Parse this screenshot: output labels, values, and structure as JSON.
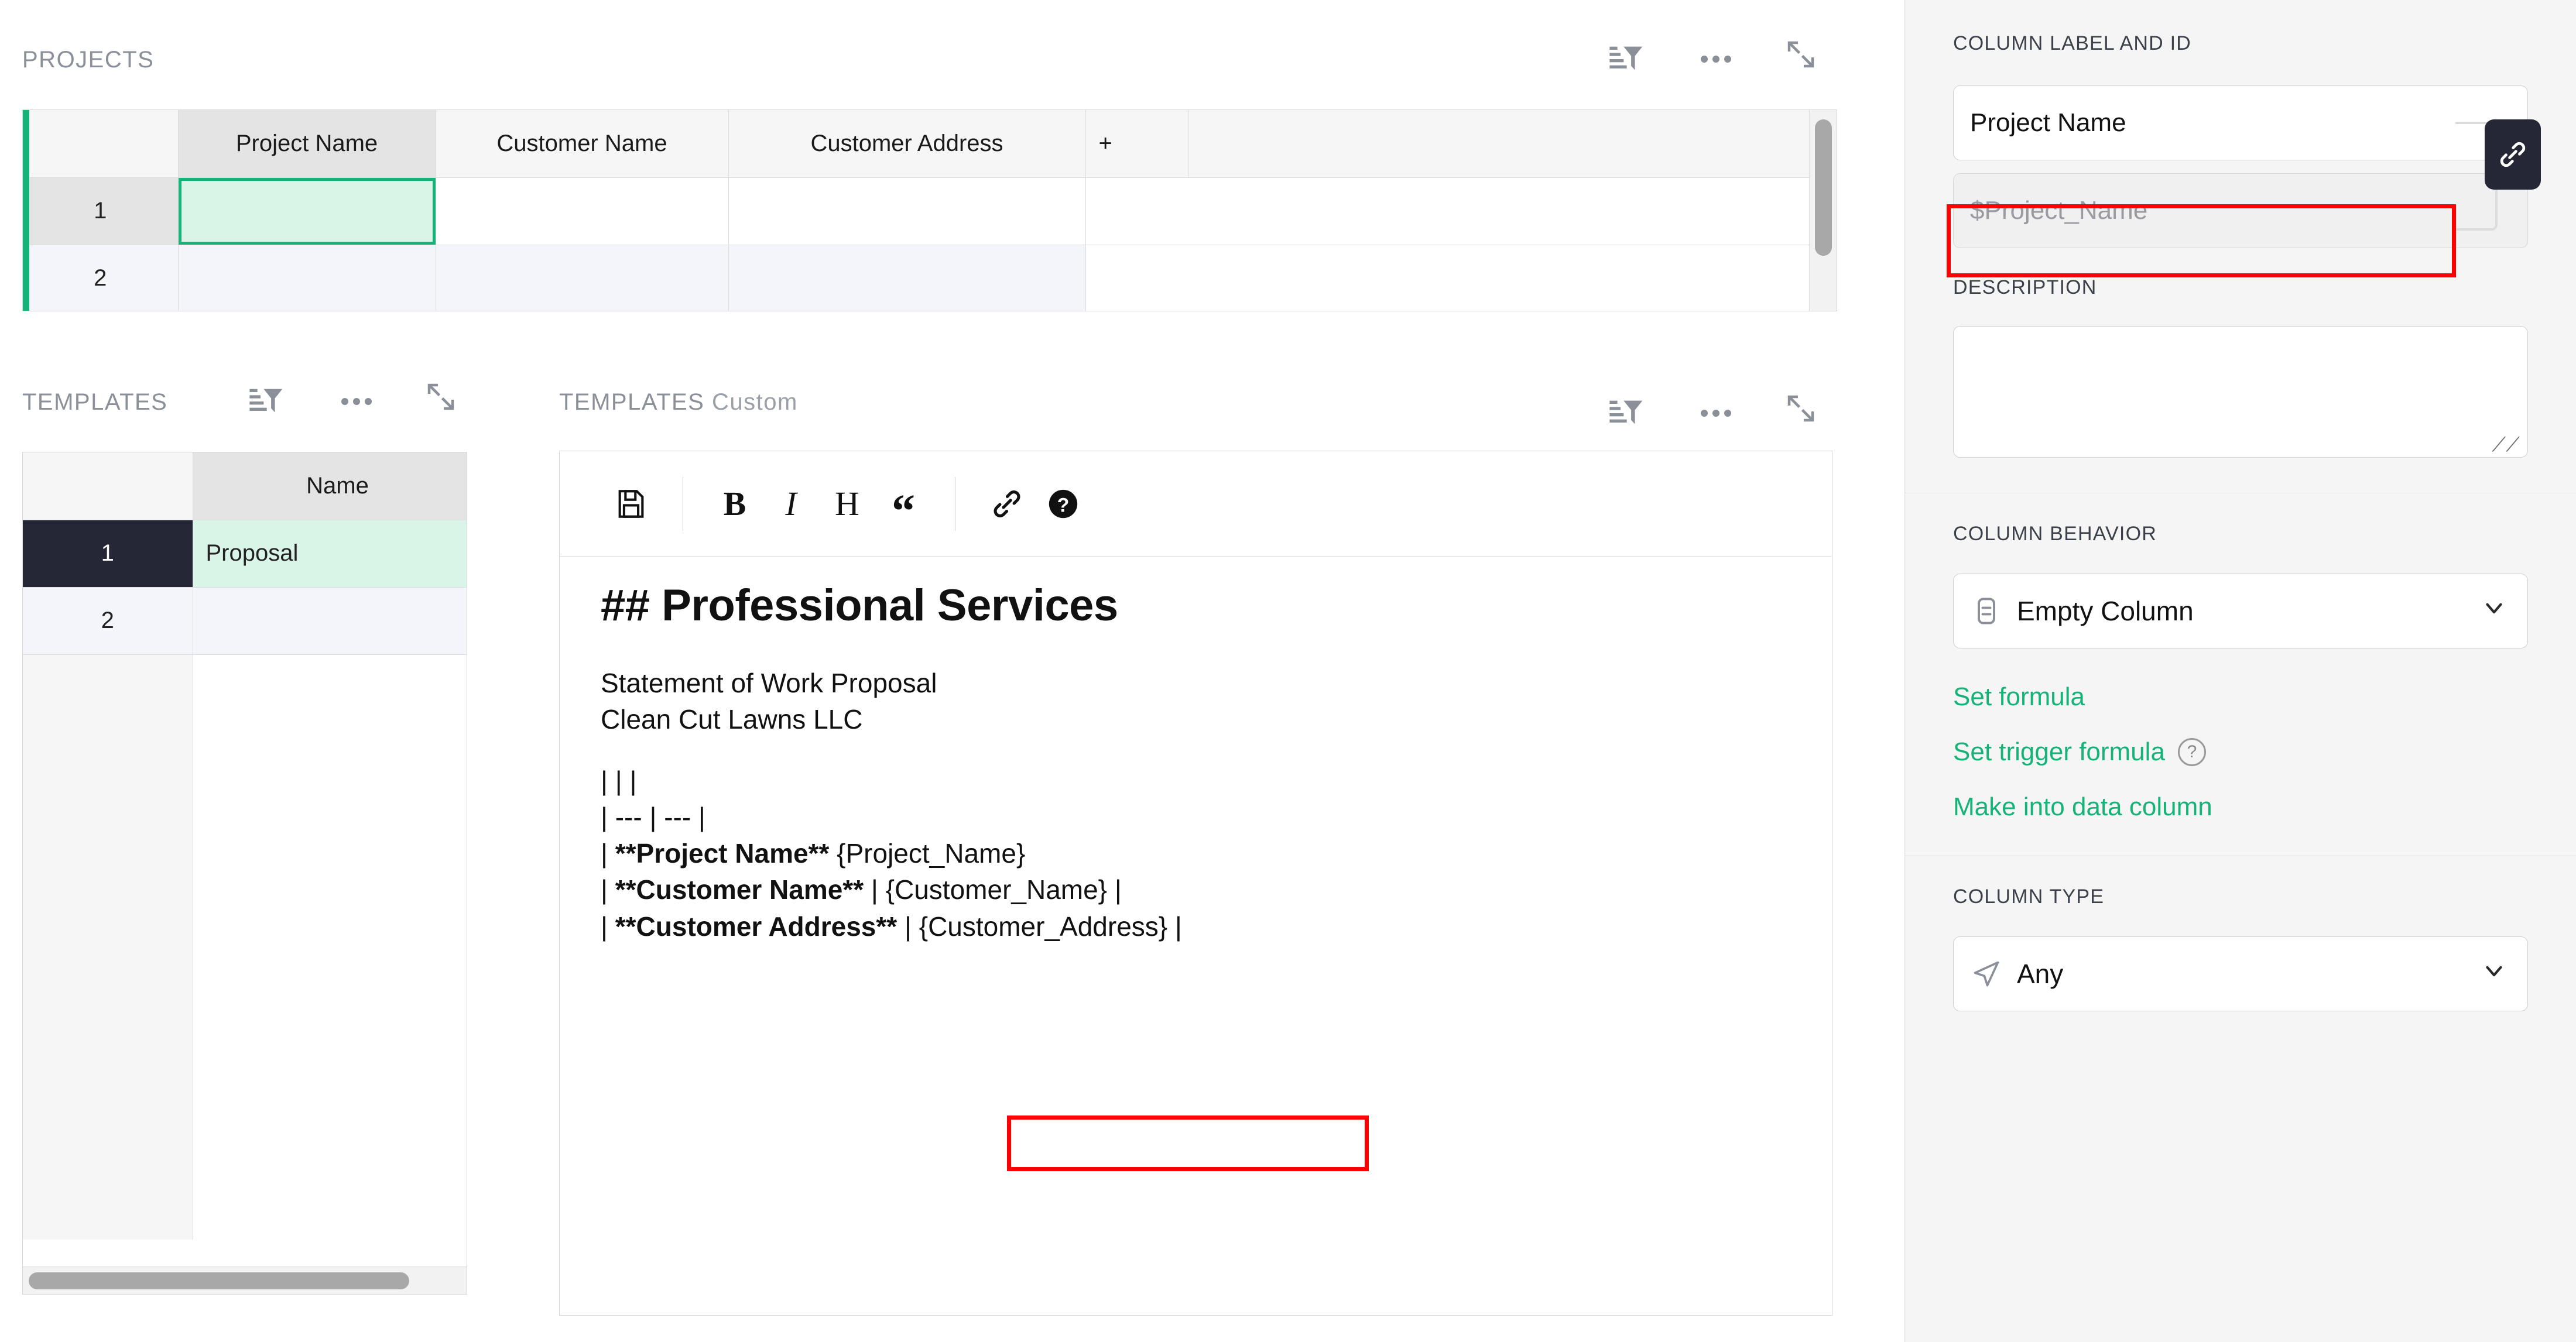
{
  "projects_panel": {
    "title": "PROJECTS",
    "icons": {
      "filter": "filter-sort-icon",
      "more": "more-options-icon",
      "expand": "expand-icon"
    },
    "columns": [
      "",
      "Project Name",
      "Customer Name",
      "Customer Address",
      "+",
      ""
    ],
    "active_column": "Project Name",
    "add_column_label": "+",
    "rows": [
      {
        "num": "1",
        "project_name": "",
        "customer_name": "",
        "customer_address": "",
        "selected": true
      },
      {
        "num": "2",
        "project_name": "",
        "customer_name": "",
        "customer_address": "",
        "selected": false
      }
    ]
  },
  "templates_panel": {
    "title": "TEMPLATES",
    "columns": [
      "",
      "Name"
    ],
    "rows": [
      {
        "num": "1",
        "name": "Proposal",
        "selected": true
      },
      {
        "num": "2",
        "name": "",
        "selected": false
      }
    ]
  },
  "templates_custom_panel": {
    "title_main": "TEMPLATES",
    "title_sub": "Custom",
    "toolbar": [
      {
        "id": "save-icon",
        "label": "save"
      },
      {
        "id": "bold-icon",
        "label": "B"
      },
      {
        "id": "italic-icon",
        "label": "I"
      },
      {
        "id": "heading-icon",
        "label": "H"
      },
      {
        "id": "quote-icon",
        "label": "“"
      },
      {
        "id": "link-icon",
        "label": "link"
      },
      {
        "id": "help-icon",
        "label": "help"
      }
    ],
    "document": {
      "heading": "## Professional Services",
      "line1": "Statement of Work Proposal",
      "line2": "Clean Cut Lawns LLC",
      "table_header": "|  |  |",
      "table_divider": "| --- | --- |",
      "rows": [
        {
          "label_pipe": "| ",
          "label": "**Project Name**",
          "sep": " ",
          "value": "{Project_Name}",
          "trailing": "",
          "highlighted": true
        },
        {
          "label_pipe": "| ",
          "label": "**Customer Name**",
          "sep": " | ",
          "value": "{Customer_Name}",
          "trailing": " |",
          "highlighted": false
        },
        {
          "label_pipe": "| ",
          "label": "**Customer Address**",
          "sep": " | ",
          "value": "{Customer_Address}",
          "trailing": " |",
          "highlighted": false
        }
      ]
    }
  },
  "creator_panel": {
    "column_label_and_id": {
      "section_label": "COLUMN LABEL AND ID",
      "label_value": "Project Name",
      "id_value": "$Project_Name",
      "link_button_icon": "link-chain-icon",
      "id_highlighted": true
    },
    "description": {
      "section_label": "DESCRIPTION",
      "value": "",
      "placeholder": ""
    },
    "column_behavior": {
      "section_label": "COLUMN BEHAVIOR",
      "selected": "Empty Column",
      "icon": "empty-column-icon",
      "links": [
        {
          "label": "Set formula",
          "help": false
        },
        {
          "label": "Set trigger formula",
          "help": true
        },
        {
          "label": "Make into data column",
          "help": false
        }
      ]
    },
    "column_type": {
      "section_label": "COLUMN TYPE",
      "selected": "Any",
      "icon": "any-type-icon"
    }
  },
  "colors": {
    "accent_green": "#16b378",
    "selection_fill": "#d9f5e7",
    "annotation_red": "#ff0000",
    "panel_bg": "#f5f5f5",
    "dark": "#262736"
  }
}
